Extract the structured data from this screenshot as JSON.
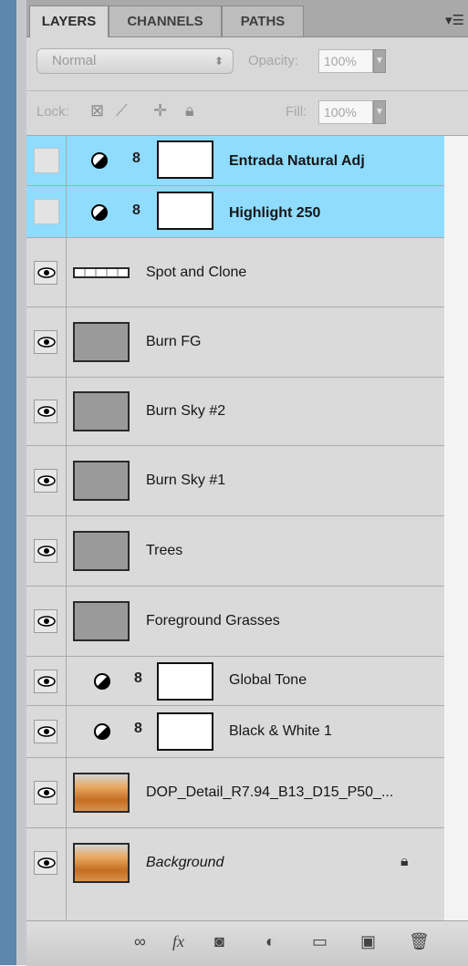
{
  "tabs": [
    "LAYERS",
    "CHANNELS",
    "PATHS"
  ],
  "blend": {
    "mode": "Normal",
    "opacity_label": "Opacity:",
    "opacity_value": "100%"
  },
  "lock": {
    "label": "Lock:",
    "fill_label": "Fill:",
    "fill_value": "100%"
  },
  "layers": [
    {
      "name": "Entrada Natural Adj",
      "type": "adjustment",
      "selected": true,
      "visible": false,
      "bold": true
    },
    {
      "name": "Highlight 250",
      "type": "adjustment",
      "selected": true,
      "visible": false,
      "bold": true
    },
    {
      "name": "Spot and Clone",
      "type": "pixel",
      "visible": true
    },
    {
      "name": "Burn FG",
      "type": "pixel",
      "visible": true
    },
    {
      "name": "Burn Sky #2",
      "type": "pixel",
      "visible": true
    },
    {
      "name": "Burn Sky #1",
      "type": "pixel",
      "visible": true
    },
    {
      "name": "Trees",
      "type": "pixel",
      "visible": true
    },
    {
      "name": "Foreground Grasses",
      "type": "pixel",
      "visible": true
    },
    {
      "name": "Global Tone",
      "type": "adjustment",
      "visible": true
    },
    {
      "name": "Black & White 1",
      "type": "adjustment",
      "visible": true
    },
    {
      "name": "DOP_Detail_R7.94_B13_D15_P50_...",
      "type": "image",
      "visible": true
    },
    {
      "name": "Background",
      "type": "image",
      "visible": true,
      "italic": true,
      "locked": true
    }
  ],
  "icons": {
    "panel_menu": "panel-menu-icon",
    "eye": "eye-icon",
    "adjustment": "adjustment-layer-icon",
    "link": "chain-link-icon",
    "lock": "lock-icon",
    "bottom": [
      "link-layers-icon",
      "fx-icon",
      "add-mask-icon",
      "new-adjustment-icon",
      "new-group-icon",
      "new-layer-icon",
      "trash-icon"
    ]
  },
  "colors": {
    "selected_row": "#8fdcff",
    "panel_bg": "#d8d8d8",
    "tab_bar": "#a9a9a9"
  }
}
